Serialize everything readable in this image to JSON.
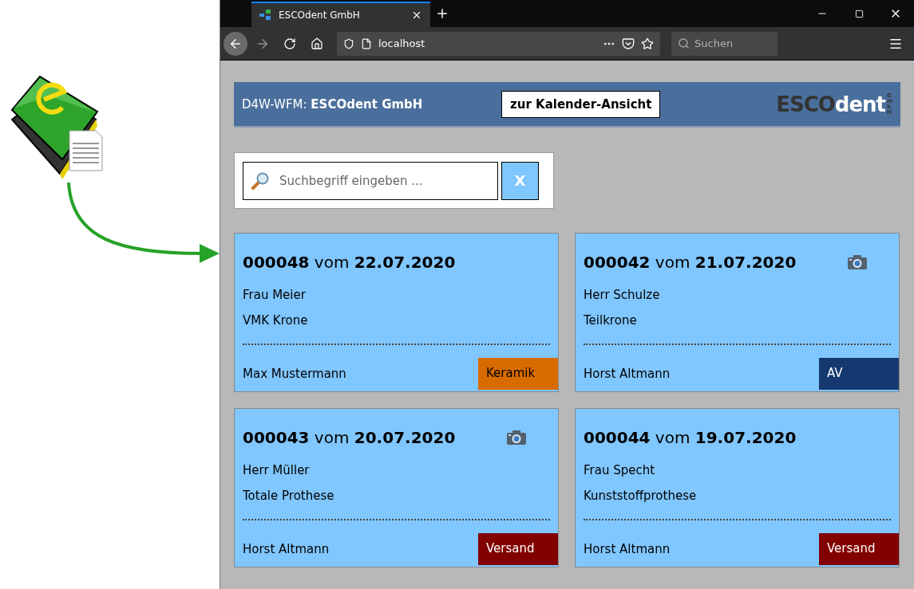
{
  "browser": {
    "tab": {
      "title": "ESCOdent GmbH",
      "selected": true
    },
    "address": "localhost",
    "search_placeholder": "Suchen"
  },
  "header": {
    "title": "D4W-WFM: **ESCOdent GmbH**",
    "calendar_button": "zur Kalender-Ansicht",
    "logo": {
      "part_1": "ESCO",
      "part_2": "dent",
      "part_3": "GmbH"
    }
  },
  "search": {
    "placeholder": "Suchbegriff eingeben ...",
    "clear_button": "X"
  },
  "orders": [
    {
      "title": "**000048** vom **22.07.2020**",
      "patient": "Frau Meier",
      "work": "VMK Krone",
      "technician": "Max Mustermann",
      "photo": false,
      "status": "Keramik",
      "color": "#d86b00"
    },
    {
      "title": "**000042** vom **21.07.2020**",
      "patient": "Herr Schulze",
      "work": "Teilkrone",
      "technician": "Horst Altmann",
      "photo": true,
      "status": "AV",
      "color": "#14386f"
    },
    {
      "title": "**000043** vom **20.07.2020**",
      "patient": "Herr Müller",
      "work": "Totale Prothese",
      "technician": "Horst Altmann",
      "photo": true,
      "status": "Versand",
      "color": "#820000"
    },
    {
      "title": "**000044** vom **19.07.2020**",
      "patient": "Frau Specht",
      "work": "Kunststoffprothese",
      "technician": "Horst Altmann",
      "photo": false,
      "status": "Versand",
      "color": "#820000"
    }
  ]
}
